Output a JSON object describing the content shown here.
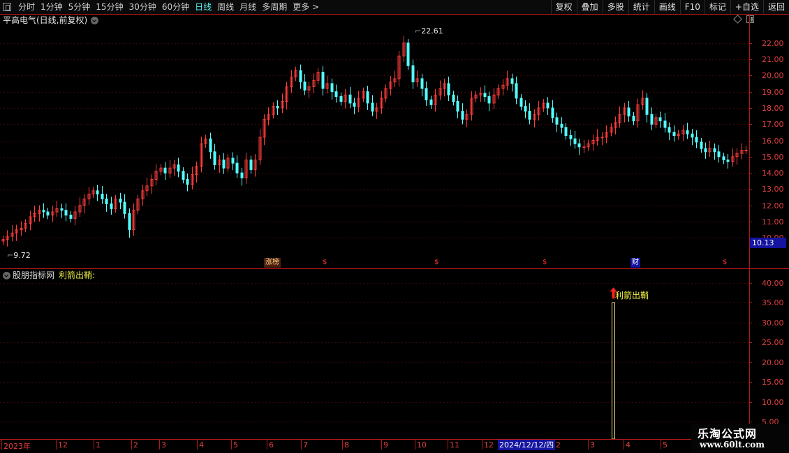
{
  "toolbar": {
    "periods": [
      "分时",
      "1分钟",
      "5分钟",
      "15分钟",
      "30分钟",
      "60分钟",
      "日线",
      "周线",
      "月线",
      "多周期",
      "更多 >"
    ],
    "active_period": "日线",
    "right_buttons": [
      "复权",
      "叠加",
      "多股",
      "统计",
      "画线",
      "F10",
      "标记",
      "+自选",
      "返回"
    ]
  },
  "chart_title": "平高电气(日线,前复权)",
  "main_chart": {
    "price_axis": [
      "22.00",
      "21.00",
      "20.00",
      "19.00",
      "18.00",
      "17.00",
      "16.00",
      "15.00",
      "14.00",
      "13.00",
      "12.00",
      "11.00",
      "10.00"
    ],
    "last_price": "10.13",
    "high_marker": "22.61",
    "low_marker": "9.72",
    "event_tags": [
      {
        "text": "涨榜",
        "color": "#e0c060"
      },
      {
        "text": "$",
        "color": "#ff3030"
      },
      {
        "text": "$",
        "color": "#ff3030"
      },
      {
        "text": "$",
        "color": "#ff3030"
      },
      {
        "text": "财",
        "color": "#ffffff"
      },
      {
        "text": "$",
        "color": "#ff3030"
      }
    ]
  },
  "indicator": {
    "name": "股朋指标网",
    "var_label": "利箭出鞘:",
    "signal_label": "利箭出鞘",
    "axis": [
      "40.00",
      "35.00",
      "30.00",
      "25.00",
      "20.00",
      "15.00",
      "10.00",
      "5.00"
    ],
    "signal_value": 35
  },
  "date_axis": {
    "labels": [
      "2023年",
      "12",
      "1",
      "2",
      "3",
      "4",
      "5",
      "6",
      "7",
      "8",
      "9",
      "10",
      "11",
      "12",
      "2",
      "3",
      "4",
      "5"
    ],
    "highlight": "2024/12/12/四"
  },
  "watermark": {
    "line1": "乐淘公式网",
    "line2": "www.60lt.com"
  },
  "colors": {
    "up": "#ff3c3c",
    "down": "#54ffff",
    "axis": "#b01818",
    "grid": "#3a0808"
  },
  "chart_data": {
    "type": "candlestick",
    "series": [
      {
        "name": "平高电气",
        "close": [
          9.9,
          10.1,
          10.3,
          10.5,
          10.6,
          10.9,
          11.3,
          11.5,
          11.7,
          11.6,
          11.4,
          11.6,
          11.8,
          11.7,
          11.4,
          11.2,
          11.6,
          12.0,
          12.4,
          12.7,
          12.9,
          12.7,
          12.4,
          12.1,
          11.8,
          12.4,
          12.2,
          11.5,
          10.5,
          11.7,
          12.4,
          12.9,
          13.2,
          13.6,
          14.1,
          14.3,
          14.0,
          14.3,
          14.5,
          14.1,
          13.6,
          13.3,
          13.9,
          14.4,
          15.8,
          16.1,
          15.3,
          14.5,
          14.8,
          14.3,
          14.9,
          14.6,
          14.0,
          13.7,
          14.8,
          14.2,
          14.8,
          16.2,
          17.3,
          17.6,
          18.1,
          18.0,
          18.4,
          19.3,
          19.9,
          20.3,
          19.6,
          19.1,
          19.3,
          19.7,
          20.2,
          19.2,
          19.5,
          19.0,
          18.7,
          18.4,
          18.8,
          18.3,
          18.1,
          18.6,
          19.0,
          18.3,
          17.8,
          18.0,
          18.6,
          19.2,
          19.6,
          19.8,
          21.2,
          22.0,
          20.6,
          19.6,
          19.8,
          19.2,
          18.5,
          18.2,
          18.8,
          19.2,
          19.5,
          18.8,
          18.4,
          17.8,
          17.3,
          17.6,
          18.6,
          18.8,
          18.9,
          18.7,
          18.3,
          18.8,
          19.2,
          19.4,
          19.8,
          19.5,
          18.6,
          18.1,
          17.8,
          17.3,
          17.6,
          18.0,
          18.3,
          18.0,
          17.4,
          17.0,
          16.8,
          16.3,
          16.1,
          15.8,
          15.6,
          15.6,
          15.8,
          16.0,
          16.2,
          16.2,
          16.5,
          16.8,
          17.1,
          17.6,
          18.0,
          17.5,
          17.2,
          18.2,
          18.6,
          17.6,
          17.0,
          17.4,
          17.2,
          16.8,
          16.5,
          16.3,
          16.4,
          16.6,
          16.4,
          16.2,
          15.9,
          15.5,
          15.3,
          15.5,
          15.3,
          15.0,
          14.8,
          14.7,
          15.0,
          15.2,
          15.4,
          15.4
        ]
      }
    ],
    "indicator_series": {
      "name": "利箭出鞘",
      "values_nonzero": [
        {
          "date_index": "2024/12 area",
          "value": 35
        }
      ]
    }
  }
}
